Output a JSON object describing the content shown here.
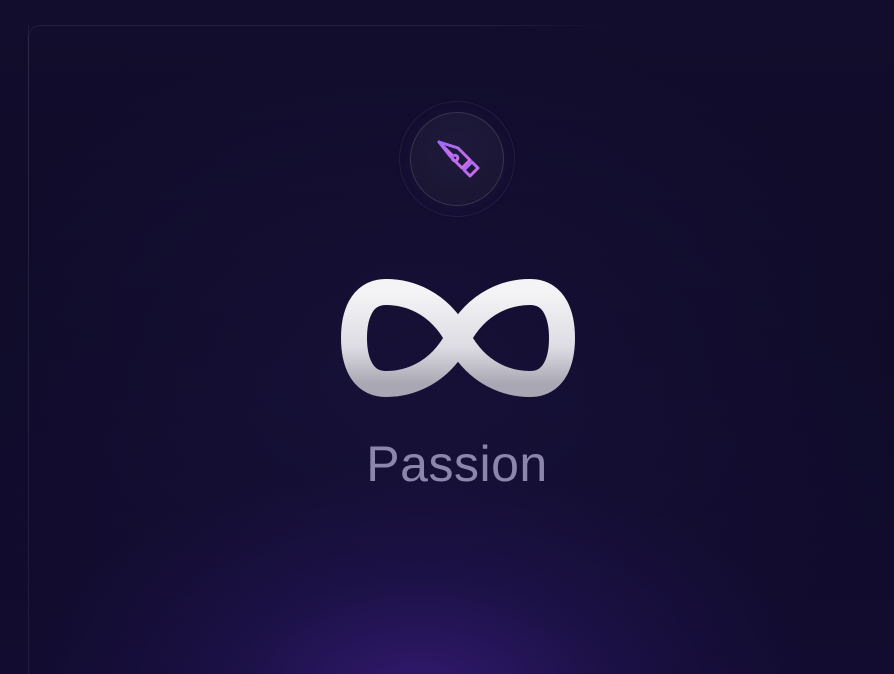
{
  "card": {
    "badge_icon": "pen-tool-icon",
    "symbol_icon": "infinity-icon",
    "caption": "Passion"
  },
  "colors": {
    "background": "#0d0a24",
    "accent": "#b06cf2",
    "symbol": "#e6e5ea",
    "caption": "#8d86ac"
  }
}
